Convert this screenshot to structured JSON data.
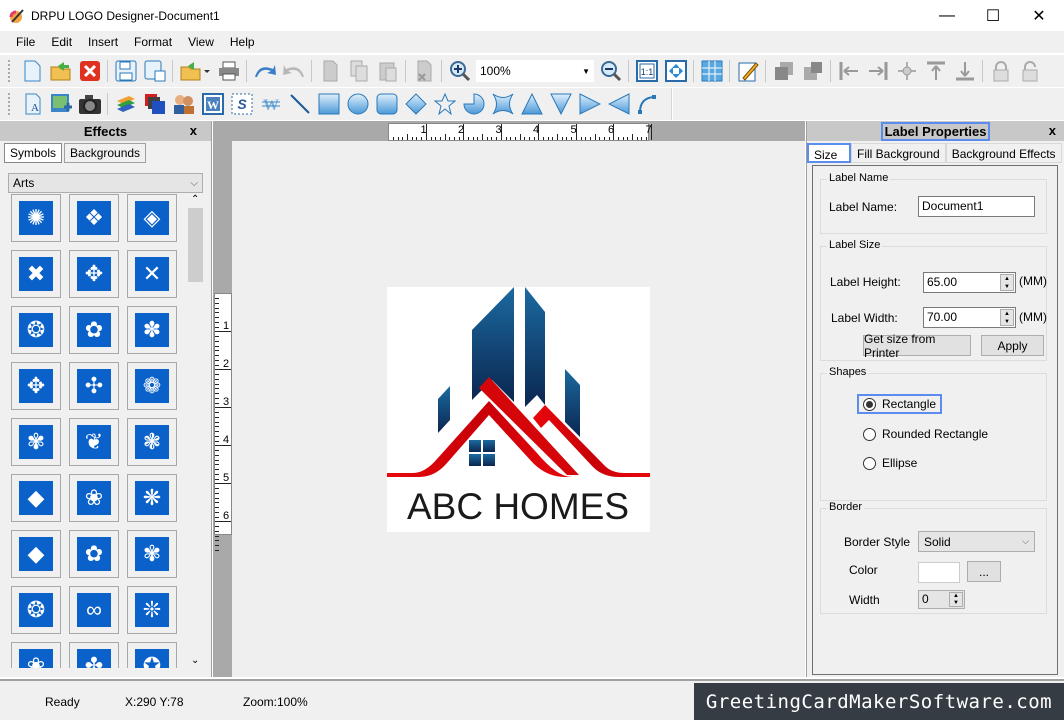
{
  "window": {
    "title": "DRPU LOGO Designer-Document1",
    "minimize_glyph": "—",
    "maximize_glyph": "☐",
    "close_glyph": "✕"
  },
  "menu": [
    "File",
    "Edit",
    "Insert",
    "Format",
    "View",
    "Help"
  ],
  "toolbar1": {
    "buttons": [
      "new-icon",
      "open-icon",
      "close-document-icon",
      "save-icon",
      "save-as-icon",
      "import-icon",
      "print-icon",
      "undo-icon",
      "redo-icon",
      "cut-icon",
      "copy-icon",
      "paste-icon",
      "delete-icon",
      "zoom-in-icon",
      "zoom-out-icon",
      "actual-size-icon",
      "fit-to-window-icon",
      "grid-icon",
      "edit-properties-icon",
      "bring-to-front-icon",
      "send-to-back-icon",
      "align-left-icon",
      "align-right-icon",
      "align-center-icon",
      "align-top-icon",
      "align-bottom-icon",
      "lock-icon",
      "unlock-icon"
    ],
    "zoom_value": "100%"
  },
  "toolbar2": {
    "buttons": [
      "text-icon",
      "image-icon",
      "camera-icon",
      "layers-icon",
      "color-fill-icon",
      "users-icon",
      "word-art-icon",
      "signature-icon",
      "watermark-icon",
      "line-icon",
      "rectangle-icon",
      "ellipse-icon",
      "rounded-rectangle-icon",
      "diamond-icon",
      "star-icon",
      "pie-icon",
      "cross-shape-icon",
      "triangle-up-icon",
      "triangle-down-icon",
      "triangle-right-icon",
      "triangle-left-icon",
      "arc-icon"
    ]
  },
  "effects_panel": {
    "title": "Effects",
    "close": "x",
    "tabs": [
      {
        "label": "Symbols",
        "active": true
      },
      {
        "label": "Backgrounds",
        "active": false
      }
    ],
    "category": "Arts",
    "symbols": [
      "✺",
      "❖",
      "◈",
      "✖",
      "✥",
      "✕",
      "❂",
      "✿",
      "✽",
      "✥",
      "✣",
      "❁",
      "✾",
      "❦",
      "❃",
      "◆",
      "❀",
      "❋",
      "◆",
      "✿",
      "✾",
      "❂",
      "∞",
      "❊",
      "❀",
      "✤",
      "✪"
    ]
  },
  "canvas": {
    "h_ruler_labels": [
      "1",
      "2",
      "3",
      "4",
      "5",
      "6",
      "7"
    ],
    "v_ruler_labels": [
      "1",
      "2",
      "3",
      "4",
      "5",
      "6"
    ],
    "logo_text": "ABC HOMES",
    "colors": {
      "blue_top": "#1b6aa0",
      "blue_bottom": "#0b2650",
      "red": "#e0080c",
      "text": "#1a1a1a"
    }
  },
  "label_properties": {
    "title": "Label Properties",
    "close": "x",
    "tabs": [
      {
        "label": "Size",
        "active": true
      },
      {
        "label": "Fill Background",
        "active": false
      },
      {
        "label": "Background Effects",
        "active": false
      }
    ],
    "label_name_group": "Label Name",
    "label_name_label": "Label Name:",
    "label_name_value": "Document1",
    "label_size_group": "Label Size",
    "height_label": "Label Height:",
    "height_value": "65.00",
    "width_label": "Label Width:",
    "width_value": "70.00",
    "unit": "(MM)",
    "get_size_button": "Get size from Printer",
    "apply_button": "Apply",
    "shapes_group": "Shapes",
    "shapes": [
      {
        "label": "Rectangle",
        "selected": true
      },
      {
        "label": "Rounded Rectangle",
        "selected": false
      },
      {
        "label": "Ellipse",
        "selected": false
      }
    ],
    "border_group": "Border",
    "border_style_label": "Border Style",
    "border_style_value": "Solid",
    "color_label": "Color",
    "color_button": "...",
    "border_width_label": "Width",
    "border_width_value": "0"
  },
  "status": {
    "state": "Ready",
    "coords": "X:290  Y:78",
    "zoom": "Zoom:100%"
  },
  "brand": "GreetingCardMakerSoftware.com"
}
